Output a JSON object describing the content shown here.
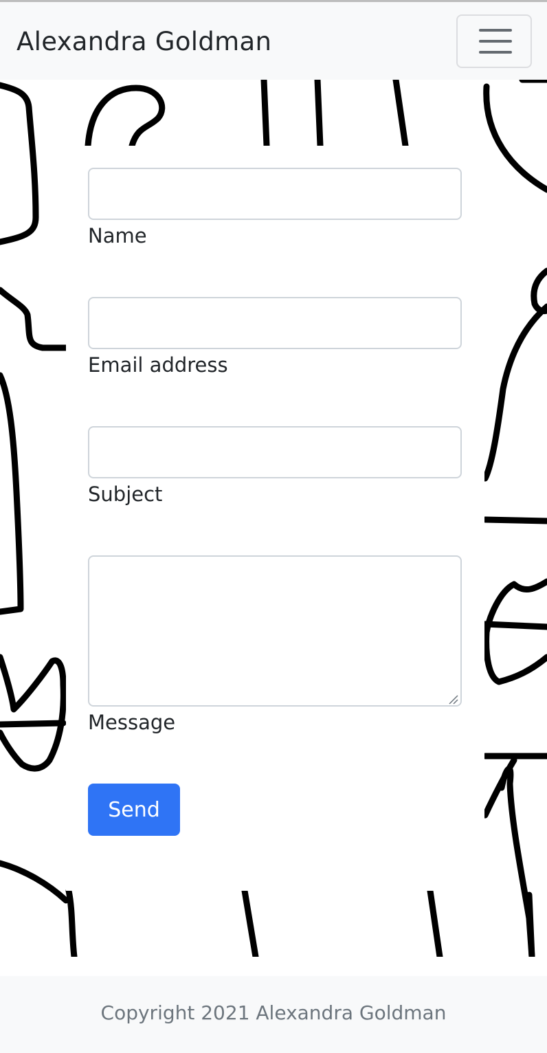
{
  "navbar": {
    "brand": "Alexandra Goldman",
    "toggle_icon": "hamburger-menu-icon"
  },
  "form": {
    "name_label": "Name",
    "email_label": "Email address",
    "subject_label": "Subject",
    "message_label": "Message",
    "name_value": "",
    "email_value": "",
    "subject_value": "",
    "message_value": "",
    "send_label": "Send"
  },
  "footer": {
    "copyright": "Copyright 2021 Alexandra Goldman"
  },
  "colors": {
    "accent": "#2f74f5",
    "navbar_bg": "#f8f9fa",
    "footer_text": "#6c757d",
    "doodle": "#000000"
  }
}
